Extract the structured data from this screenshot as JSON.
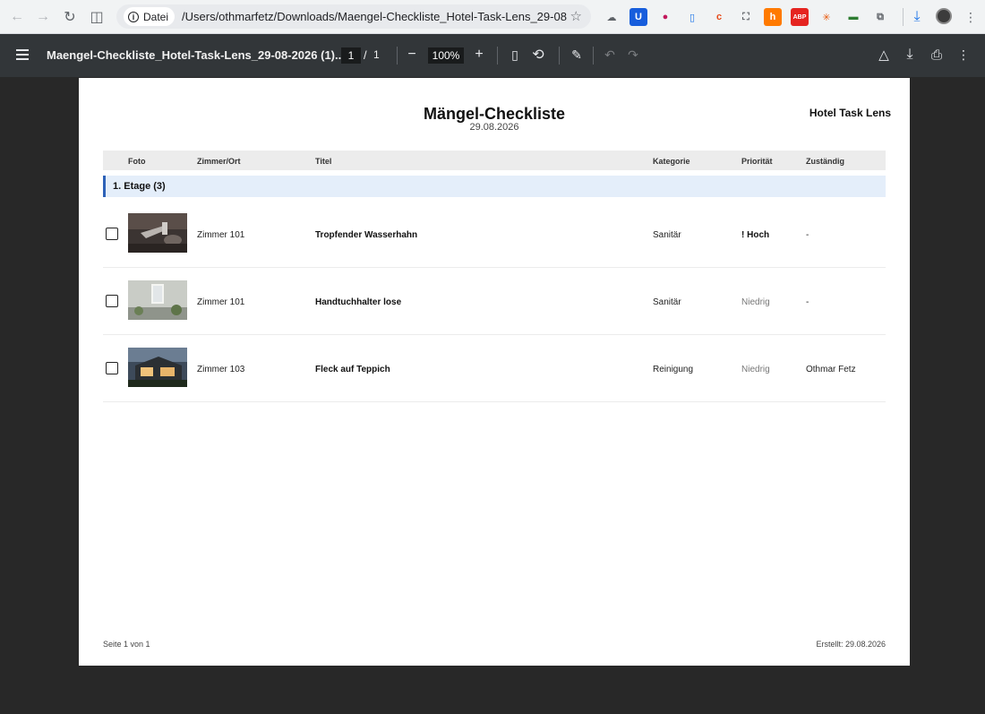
{
  "browser": {
    "site_chip": "Datei",
    "url": "/Users/othmarfetz/Downloads/Maengel-Checkliste_Hotel-Task-Lens_29-08-...",
    "extensions": [
      {
        "name": "cloud-icon",
        "glyph": "☁",
        "bg": "transparent",
        "color": "#5f6368"
      },
      {
        "name": "bitwarden-icon",
        "glyph": "U",
        "bg": "#175ddc",
        "color": "#ffffff"
      },
      {
        "name": "color-picker-icon",
        "glyph": "●",
        "bg": "transparent",
        "color": "#c2185b"
      },
      {
        "name": "mobile-icon",
        "glyph": "▯",
        "bg": "transparent",
        "color": "#1a73e8"
      },
      {
        "name": "sync-icon",
        "glyph": "c",
        "bg": "transparent",
        "color": "#e64a19"
      },
      {
        "name": "screenshot-icon",
        "glyph": "⛶",
        "bg": "transparent",
        "color": "#5f6368"
      },
      {
        "name": "hubspot-icon",
        "glyph": "h",
        "bg": "#ff7a00",
        "color": "#ffffff"
      },
      {
        "name": "adblock-icon",
        "glyph": "ABP",
        "bg": "#e52420",
        "color": "#ffffff"
      },
      {
        "name": "spark-icon",
        "glyph": "✳",
        "bg": "transparent",
        "color": "#e8590c"
      },
      {
        "name": "palette-icon",
        "glyph": "▬",
        "bg": "transparent",
        "color": "#2e7d32"
      },
      {
        "name": "puzzle-icon",
        "glyph": "⧉",
        "bg": "transparent",
        "color": "#5f6368"
      }
    ]
  },
  "pdf_toolbar": {
    "title": "Maengel-Checkliste_Hotel-Task-Lens_29-08-2026 (1)....",
    "current_page": "1",
    "page_separator": "/",
    "total_pages": "1",
    "zoom": "100%"
  },
  "document": {
    "heading": "Mängel-Checkliste",
    "date": "29.08.2026",
    "brand": "Hotel Task Lens",
    "columns": {
      "foto": "Foto",
      "zimmer": "Zimmer/Ort",
      "titel": "Titel",
      "kategorie": "Kategorie",
      "prioritaet": "Priorität",
      "zustaendig": "Zuständig"
    },
    "group_label": "1. Etage (3)",
    "rows": [
      {
        "room": "Zimmer 101",
        "title": "Tropfender Wasserhahn",
        "category": "Sanitär",
        "priority": "! Hoch",
        "assignee": "-"
      },
      {
        "room": "Zimmer 101",
        "title": "Handtuchhalter lose",
        "category": "Sanitär",
        "priority": "Niedrig",
        "assignee": "-"
      },
      {
        "room": "Zimmer 103",
        "title": "Fleck auf Teppich",
        "category": "Reinigung",
        "priority": "Niedrig",
        "assignee": "Othmar Fetz"
      }
    ],
    "footer_left": "Seite 1 von 1",
    "footer_right": "Erstellt: 29.08.2026"
  }
}
